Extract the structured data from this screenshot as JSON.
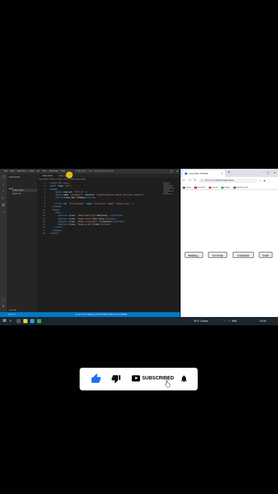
{
  "vscode": {
    "menu": [
      "File",
      "Edit",
      "Selection",
      "View",
      "Go",
      "Run",
      "Terminal",
      "Help"
    ],
    "window_title": "index.html - box - Visual Studio Code",
    "explorer_label": "EXPLORER",
    "folder": "BOX",
    "files": [
      "index.html",
      "style.css"
    ],
    "outline": "OUTLINE",
    "tabs": [
      "index.html",
      "style.css"
    ],
    "breadcrumb": "index.html > html > body > div > button.demo-help",
    "lines": [
      {
        "n": "1",
        "html": "<span class='t-doc'>&lt;!DOCTYPE html&gt;</span>"
      },
      {
        "n": "2",
        "html": "<span class='t-tag'>&lt;html</span> <span class='t-attr'>lang</span>=<span class='t-str'>\"en\"</span><span class='t-tag'>&gt;</span>"
      },
      {
        "n": "3",
        "html": "<span class='t-tag'>&lt;head&gt;</span>"
      },
      {
        "n": "4",
        "html": "    <span class='t-tag'>&lt;meta</span> <span class='t-attr'>charset</span>=<span class='t-str'>\"UTF-8\"</span> <span class='t-tag'>/&gt;</span>"
      },
      {
        "n": "5",
        "html": "    <span class='t-tag'>&lt;meta</span> <span class='t-attr'>name</span>=<span class='t-str'>\"viewport\"</span> <span class='t-attr'>content</span>=<span class='t-str'>\"width=device-width,initial-scale=1</span>"
      },
      {
        "n": "6",
        "html": "    <span class='t-tag'>&lt;title&gt;</span><span class='t-txt'>Long Box Shadow</span><span class='t-tag'>&lt;/title&gt;</span>"
      },
      {
        "n": "7",
        "html": ""
      },
      {
        "n": "8",
        "html": "    <span class='t-tag'>&lt;link</span> <span class='t-attr'>rel</span>=<span class='t-str'>\"stylesheet\"</span> <span class='t-attr'>type</span>=<span class='t-str'>\"text/css\"</span> <span class='t-attr'>href</span>=<span class='t-str'>\"style.css\"</span> <span class='t-tag'>/&gt;</span>"
      },
      {
        "n": "9",
        "html": "  <span class='t-tag'>&lt;/head&gt;</span>"
      },
      {
        "n": "10",
        "html": "  <span class='t-tag'>&lt;body&gt;</span>"
      },
      {
        "n": "11",
        "html": "    <span class='t-tag'>&lt;div&gt;</span>"
      },
      {
        "n": "12",
        "html": "      <span class='t-tag'>&lt;button</span> <span class='t-attr'>class</span>=<span class='t-str'>\"demo-waiting\"</span><span class='t-tag'>&gt;</span><span class='t-txt'>Waiting...</span><span class='t-tag'>&lt;/button&gt;</span>"
      },
      {
        "n": "13",
        "html": "      <span class='t-tag'>&lt;button</span> <span class='t-attr'>class</span>=<span class='t-str'>\"demo-help\"</span><span class='t-tag'>&gt;</span><span class='t-txt'>Get help</span><span class='t-tag'>&lt;/button&gt;</span>"
      },
      {
        "n": "14",
        "html": "      <span class='t-tag'>&lt;button</span> <span class='t-attr'>class</span>=<span class='t-str'>\"demo-crosshair\"</span><span class='t-tag'>&gt;</span><span class='t-txt'>Crosshair</span><span class='t-tag'>&lt;/button&gt;</span>"
      },
      {
        "n": "15",
        "html": "      <span class='t-tag'>&lt;button</span> <span class='t-attr'>class</span>=<span class='t-str'>\"demo-grab\"</span><span class='t-tag'>&gt;</span><span class='t-txt'>Grab</span><span class='t-tag'>&lt;/button&gt;</span>"
      },
      {
        "n": "16",
        "html": "    <span class='t-tag'>&lt;/div&gt;</span>"
      },
      {
        "n": "17",
        "html": "  <span class='t-tag'>&lt;/body&gt;</span>"
      },
      {
        "n": "18",
        "html": "<span class='t-tag'>&lt;/html&gt;</span>"
      }
    ],
    "status_left": "⊗ 0 ⚠ 0",
    "status_right": "Ln 13, Col 31   Spaces: 2   UTF-8   CRLF   HTML   Go Live   Prettier"
  },
  "browser": {
    "tab_title": "Long Box Shadow",
    "url": "127.0.0.1:5500/index.html",
    "bookmarks": [
      {
        "label": "Apps",
        "color": "#5f6368"
      },
      {
        "label": "YouTube",
        "color": "#ff0000"
      },
      {
        "label": "Gmail",
        "color": "#ea4335"
      },
      {
        "label": "Maps",
        "color": "#34a853"
      },
      {
        "label": "Reading list",
        "color": "#5f6368"
      }
    ],
    "buttons": {
      "waiting": "Waiting...",
      "help": "Get help",
      "crosshair": "Crosshair",
      "grab": "Grab"
    }
  },
  "taskbar": {
    "weather": "30°C Cloudy",
    "lang": "ENG",
    "time": "13:40"
  },
  "subscribe": {
    "label": "SUBSCRIBED"
  },
  "colors": {
    "vscode_bg": "#1e1e1e",
    "status_bar": "#007acc",
    "accent_yellow": "#e8c21a"
  }
}
